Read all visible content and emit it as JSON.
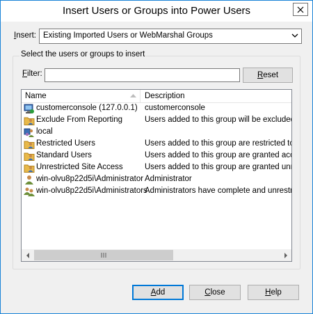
{
  "window": {
    "title": "Insert Users or Groups into Power Users"
  },
  "insert": {
    "label_pre": "",
    "label_accel": "I",
    "label_post": "nsert:",
    "selected": "Existing Imported Users or WebMarshal Groups"
  },
  "group": {
    "caption": "Select the users or groups to insert"
  },
  "filter": {
    "label_accel": "F",
    "label_post": "ilter:",
    "value": ""
  },
  "buttons": {
    "reset_accel": "R",
    "reset_post": "eset",
    "add_accel": "A",
    "add_post": "dd",
    "close_accel": "C",
    "close_post": "lose",
    "help_accel": "H",
    "help_post": "elp"
  },
  "list": {
    "columns": [
      "Name",
      "Description"
    ],
    "rows": [
      {
        "name": "customerconsole (127.0.0.1)",
        "desc": "customerconsole",
        "icon": "computer-icon"
      },
      {
        "name": "Exclude From Reporting",
        "desc": "Users added to this group will be excluded fror",
        "icon": "folder-user-icon"
      },
      {
        "name": "local",
        "desc": "",
        "icon": "domain-icon"
      },
      {
        "name": "Restricted Users",
        "desc": "Users added to this group are restricted to only",
        "icon": "folder-user-icon"
      },
      {
        "name": "Standard Users",
        "desc": "Users added to this group are granted access",
        "icon": "folder-user-icon"
      },
      {
        "name": "Unrestricted Site Access",
        "desc": "Users added to this group are granted unrestri",
        "icon": "folder-user-icon"
      },
      {
        "name": "win-olvu8p22d5i\\Administrator",
        "desc": "Administrator",
        "icon": "user-icon"
      },
      {
        "name": "win-olvu8p22d5i\\Administrators",
        "desc": "Administrators have complete and unrestricted",
        "icon": "users-icon"
      }
    ]
  },
  "colors": {
    "accent": "#0078d7",
    "window_border": "#1883d7",
    "face": "#f0f0f0"
  }
}
